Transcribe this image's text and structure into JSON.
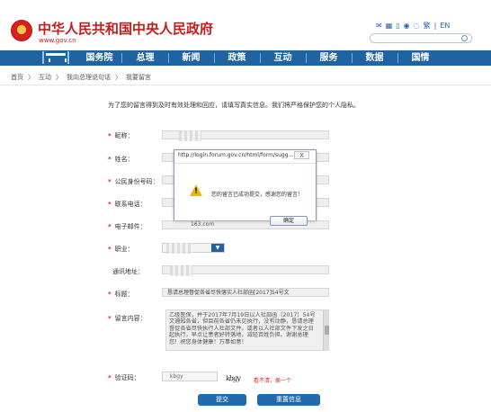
{
  "header": {
    "title": "中华人民共和国中央人民政府",
    "domain": "www.gov.cn",
    "icons": [
      "mail-icon",
      "grid-icon",
      "mobile-icon",
      "weibo-icon",
      "wechat-icon"
    ],
    "lang_labels": [
      "繁",
      "EN"
    ]
  },
  "nav": {
    "items": [
      "国务院",
      "总理",
      "新闻",
      "政策",
      "互动",
      "服务",
      "数据",
      "国情"
    ]
  },
  "breadcrumb": [
    "首页",
    "互动",
    "我向总理说句话",
    "我要留言"
  ],
  "notice": "为了您的留言得到及时有效处理和回应，请填写真实信息。我们将严格保护您的个人隐私。",
  "form": {
    "labels": [
      "昵称：",
      "姓名：",
      "公民身份号码：",
      "联系电话：",
      "电子邮件：",
      "职业：",
      "通讯地址：",
      "标题：",
      "留言内容：",
      "验证码："
    ],
    "email_suffix": "163.com",
    "title_value": "恳请总理督促各省尽快落实人社部函[2017]54号文",
    "message_value": "乙级医保，并于2017年7月19日以人社部函〔2017〕54号文通知各省，但目前各省仍未见执行，没有动静，恳请总理督促各省尽快执行人社部文件，或者以人社部文件下发之日起执行，早点让患者好转落地，减轻百姓负担。谢谢总理您！祝您身体健康！万事如意！",
    "captcha_value": "kbgy",
    "captcha_image_text": "kbgy",
    "captcha_refresh": "看不清，换一个",
    "submit": "提交",
    "reset": "重置信息"
  },
  "dialog": {
    "title": "http://login.forum.gov.cn/html/form/sugg...",
    "close": "X",
    "message": "您的留言已成功提交，感谢您的留言！",
    "ok": "确定"
  }
}
